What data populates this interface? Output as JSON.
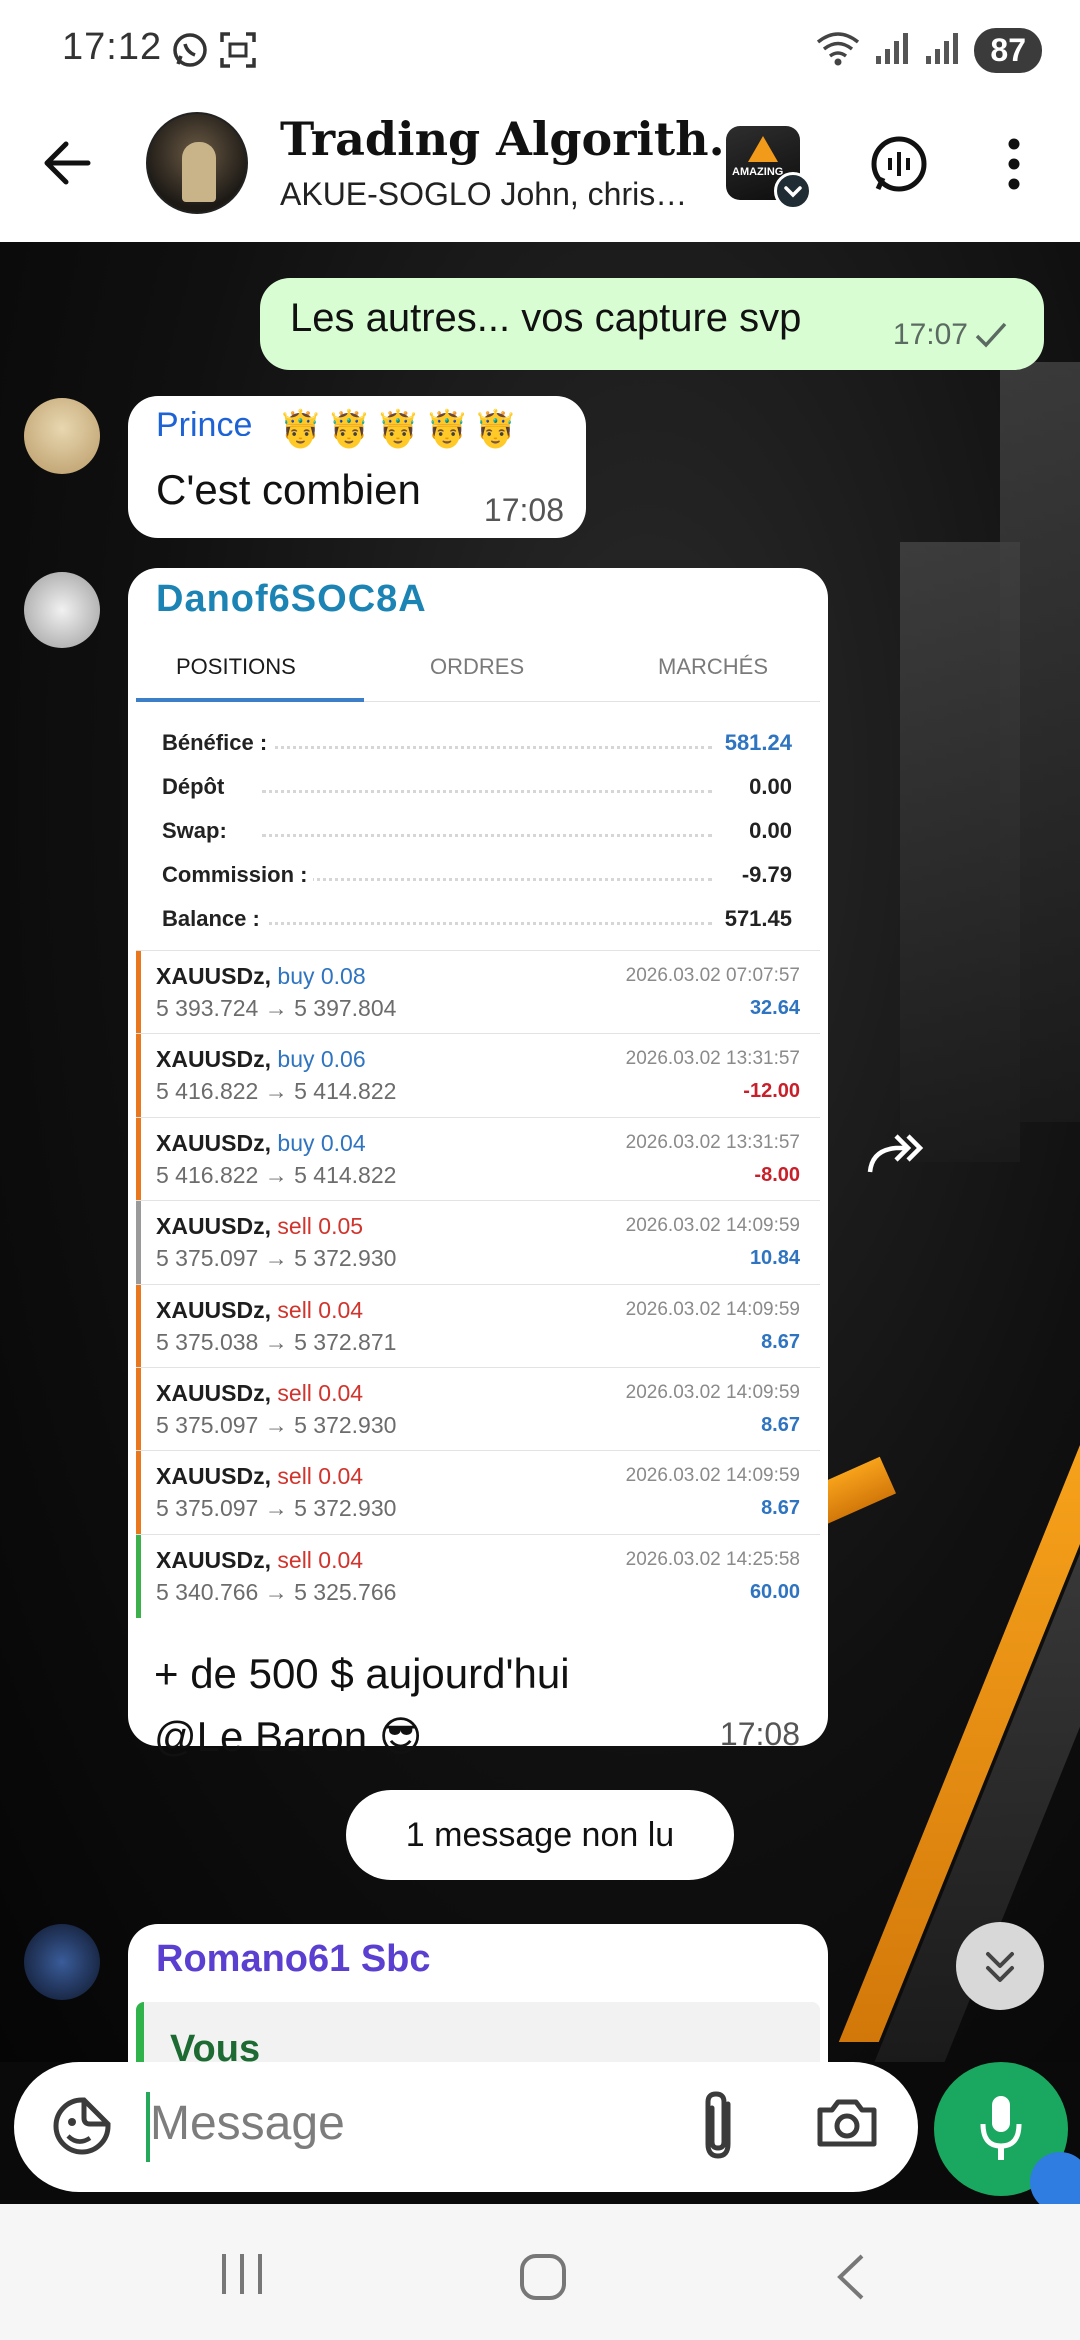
{
  "status_bar": {
    "time": "17:12",
    "battery": "87",
    "icons": [
      "whatsapp-icon",
      "screenshot-icon",
      "wifi-icon",
      "signal-icon",
      "signal-icon"
    ]
  },
  "header": {
    "title": "Trading Algorith…",
    "subtitle": "AKUE-SOGLO John, chris…",
    "app_badge_text": "AMAZING"
  },
  "messages": {
    "outgoing_1": {
      "text": "Les autres... vos capture svp",
      "time": "17:07"
    },
    "incoming_1": {
      "sender": "Prince",
      "crowns": "🤴🤴🤴🤴🤴",
      "text": "C'est combien",
      "time": "17:08"
    },
    "incoming_2": {
      "sender": "Danof6SOC8A",
      "caption_line1": "+ de 500 $ aujourd'hui",
      "caption_line2": "@Le Baron 😎",
      "time": "17:08"
    },
    "unread_banner": "1 message non lu",
    "incoming_3": {
      "sender": "Romano61 Sbc",
      "reply_to": "Vous"
    }
  },
  "screenshot": {
    "tabs": [
      "POSITIONS",
      "ORDRES",
      "MARCHÉS"
    ],
    "active_tab": "POSITIONS",
    "summary": [
      {
        "label": "Bénéfice :",
        "value": "581.24",
        "highlight": true
      },
      {
        "label": "Dépôt",
        "value": "0.00",
        "highlight": false
      },
      {
        "label": "Swap:",
        "value": "0.00",
        "highlight": false
      },
      {
        "label": "Commission :",
        "value": "-9.79",
        "highlight": false
      },
      {
        "label": "Balance :",
        "value": "571.45",
        "highlight": false
      }
    ],
    "trades": [
      {
        "symbol": "XAUUSDz,",
        "side": "buy 0.08",
        "prices": "5 393.724 → 5 397.804",
        "date": "2026.03.02 07:07:57",
        "profit": "32.64"
      },
      {
        "symbol": "XAUUSDz,",
        "side": "buy 0.06",
        "prices": "5 416.822 → 5 414.822",
        "date": "2026.03.02 13:31:57",
        "profit": "-12.00"
      },
      {
        "symbol": "XAUUSDz,",
        "side": "buy 0.04",
        "prices": "5 416.822 → 5 414.822",
        "date": "2026.03.02 13:31:57",
        "profit": "-8.00"
      },
      {
        "symbol": "XAUUSDz,",
        "side": "sell 0.05",
        "prices": "5 375.097 → 5 372.930",
        "date": "2026.03.02 14:09:59",
        "profit": "10.84"
      },
      {
        "symbol": "XAUUSDz,",
        "side": "sell 0.04",
        "prices": "5 375.038 → 5 372.871",
        "date": "2026.03.02 14:09:59",
        "profit": "8.67"
      },
      {
        "symbol": "XAUUSDz,",
        "side": "sell 0.04",
        "prices": "5 375.097 → 5 372.930",
        "date": "2026.03.02 14:09:59",
        "profit": "8.67"
      },
      {
        "symbol": "XAUUSDz,",
        "side": "sell 0.04",
        "prices": "5 375.097 → 5 372.930",
        "date": "2026.03.02 14:09:59",
        "profit": "8.67"
      },
      {
        "symbol": "XAUUSDz,",
        "side": "sell 0.04",
        "prices": "5 340.766 → 5 325.766",
        "date": "2026.03.02 14:25:58",
        "profit": "60.00"
      }
    ],
    "colors": {
      "buy": "#2f74c0",
      "sell": "#d0342c",
      "profit_positive": "#2f74c0",
      "profit_negative": "#c8202a"
    }
  },
  "composer": {
    "placeholder": "Message"
  },
  "colors": {
    "accent_green": "#1aa760",
    "outgoing_bubble": "#d9fdd3"
  }
}
